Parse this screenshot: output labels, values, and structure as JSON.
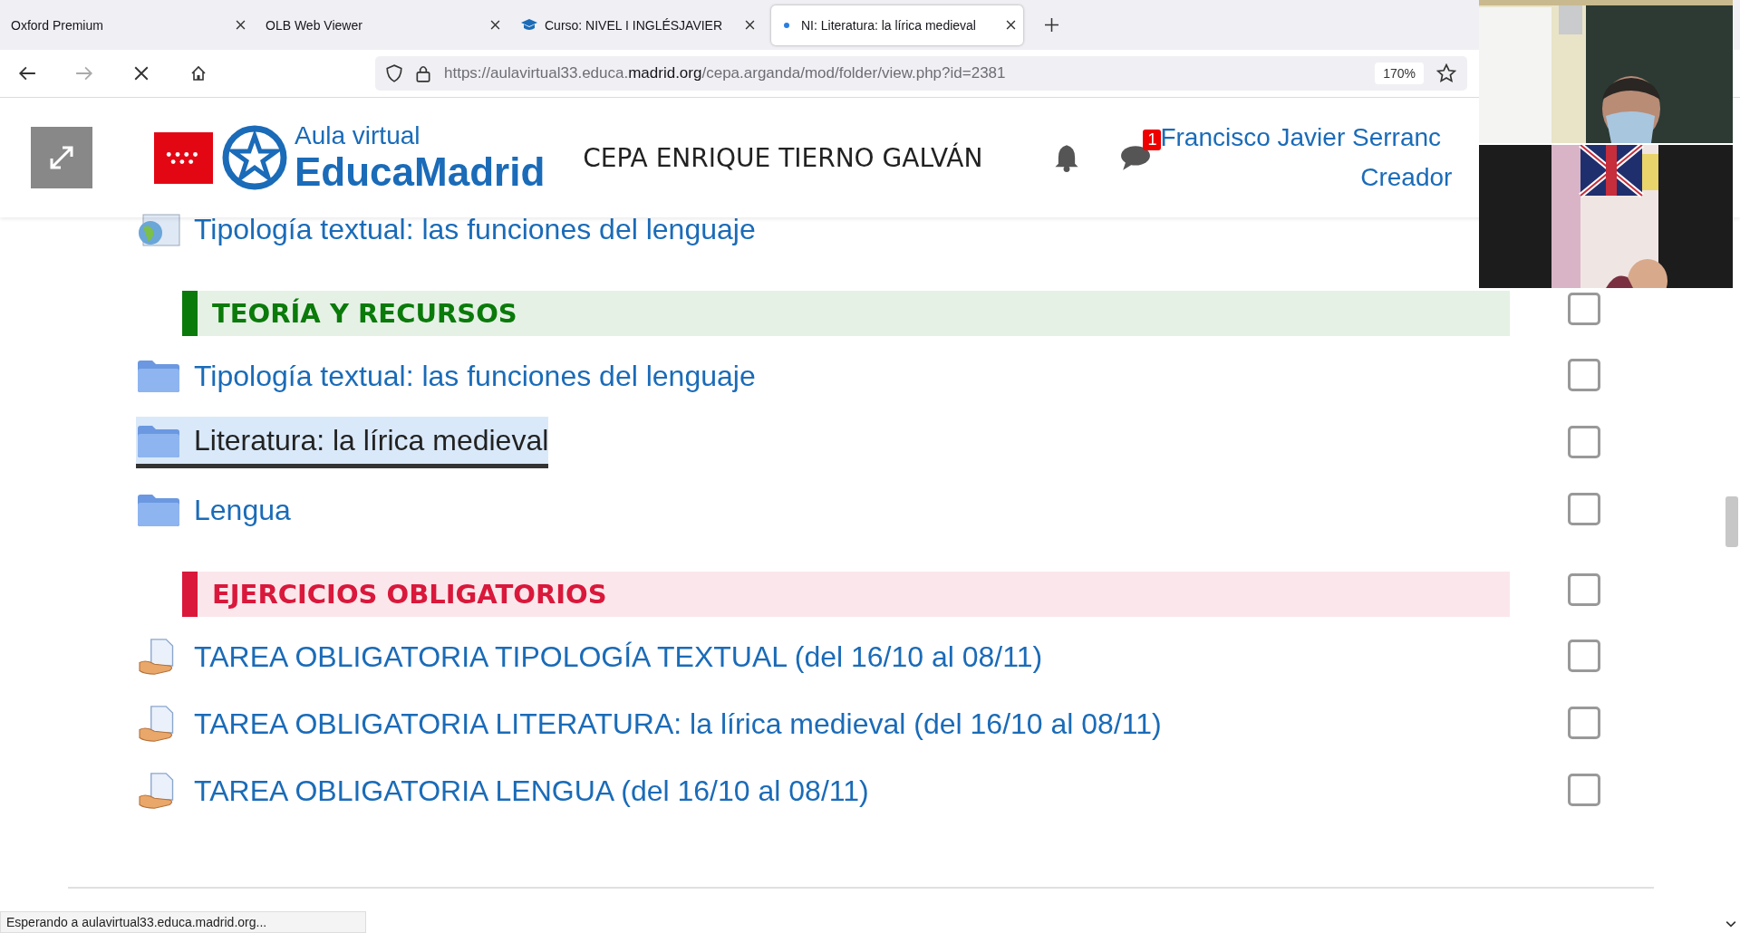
{
  "tabs": [
    {
      "label": "Oxford Premium",
      "selected": false,
      "kind": "plain"
    },
    {
      "label": "OLB Web Viewer",
      "selected": false,
      "kind": "plain"
    },
    {
      "label": "Curso: NIVEL I INGLÉSJAVIER",
      "selected": false,
      "kind": "course"
    },
    {
      "label": "NI: Literatura: la lírica medieval",
      "selected": true,
      "kind": "loading"
    }
  ],
  "address_bar": {
    "url_prefix": "https://aulavirtual33.educa.",
    "url_domain": "madrid.org",
    "url_path": "/cepa.arganda/mod/folder/view.php?id=2381",
    "zoom": "170%"
  },
  "header": {
    "logo_top": "Aula virtual",
    "logo_bottom": "EducaMadrid",
    "school": "CEPA ENRIQUE TIERNO GALVÁN",
    "messages_badge": "1",
    "user_name": "Francisco Javier Serranc",
    "user_role": "Creador"
  },
  "content": [
    {
      "kind": "page",
      "text": "Tipología textual: las funciones del lenguaje",
      "selected": false
    },
    {
      "kind": "section",
      "text": "TEORÍA Y RECURSOS",
      "color": "#0a7a0a",
      "checked": false
    },
    {
      "kind": "folder",
      "text": "Tipología textual: las funciones del lenguaje",
      "selected": false,
      "checked": false
    },
    {
      "kind": "folder",
      "text": "Literatura: la lírica medieval",
      "selected": true,
      "checked": false
    },
    {
      "kind": "folder",
      "text": "Lengua",
      "selected": false,
      "checked": false
    },
    {
      "kind": "section",
      "text": "EJERCICIOS OBLIGATORIOS",
      "color": "#d9183b",
      "checked": false
    },
    {
      "kind": "assignment",
      "text": "TAREA OBLIGATORIA TIPOLOGÍA TEXTUAL (del 16/10 al 08/11)",
      "selected": false,
      "checked": false
    },
    {
      "kind": "assignment",
      "text": "TAREA OBLIGATORIA LITERATURA: la lírica medieval (del 16/10 al 08/11)",
      "selected": false,
      "checked": false
    },
    {
      "kind": "assignment",
      "text": "TAREA OBLIGATORIA LENGUA (del 16/10 al 08/11)",
      "selected": false,
      "checked": false
    }
  ],
  "status_bar": {
    "text": "Esperando a aulavirtual33.educa.madrid.org..."
  }
}
